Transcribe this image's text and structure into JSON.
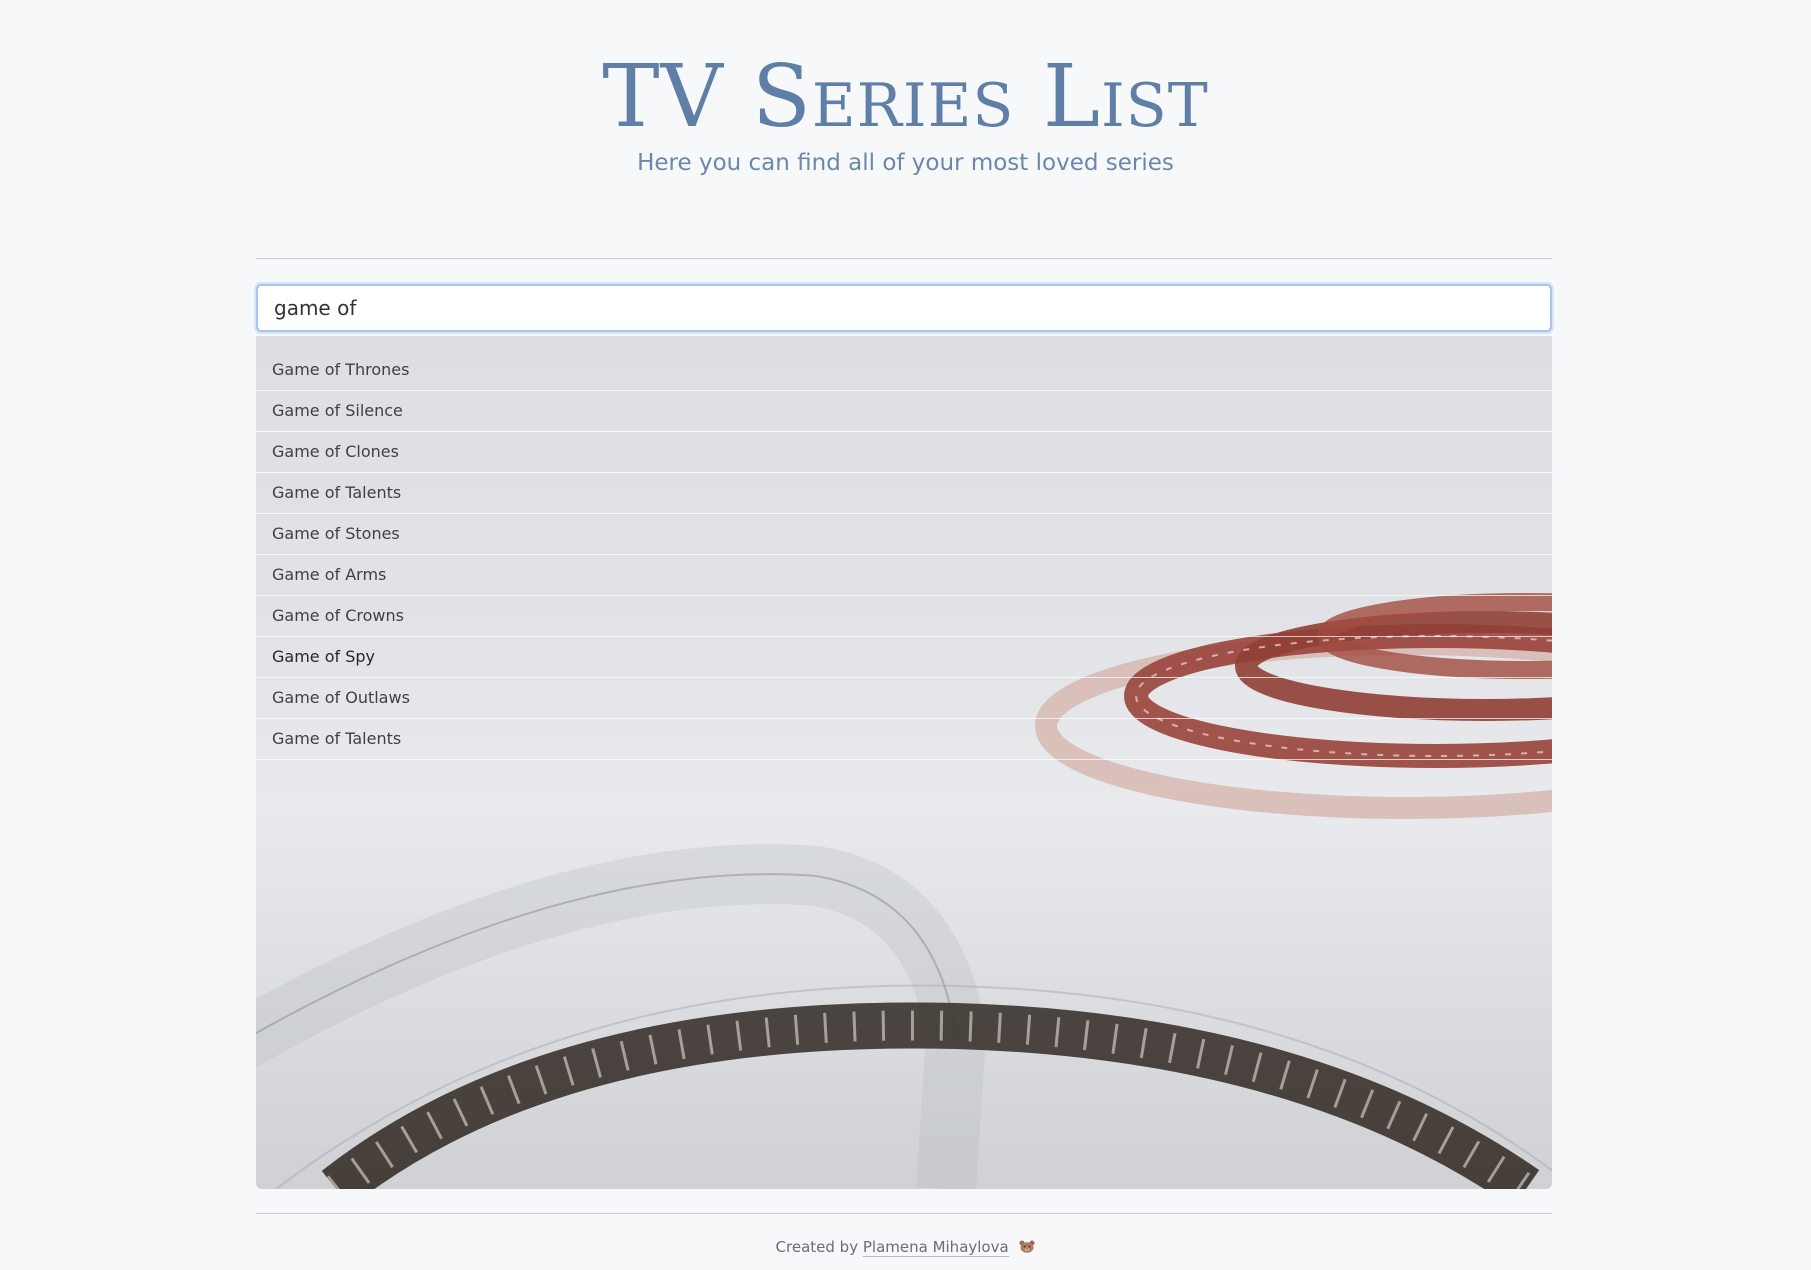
{
  "header": {
    "title": "TV Series List",
    "subtitle": "Here you can find all of your most loved series"
  },
  "search": {
    "value": "game of",
    "placeholder": ""
  },
  "results": [
    "Game of Thrones",
    "Game of Silence",
    "Game of Clones",
    "Game of Talents",
    "Game of Stones",
    "Game of Arms",
    "Game of Crowns",
    "Game of Spy",
    "Game of Outlaws",
    "Game of Talents"
  ],
  "footer": {
    "prefix": "Created by",
    "author": "Plamena Mihaylova",
    "icon": "bear-face-icon"
  },
  "colors": {
    "title": "#5f7fa7",
    "accent_border": "#a9c5ee",
    "page_background": "#f7f8fa"
  }
}
